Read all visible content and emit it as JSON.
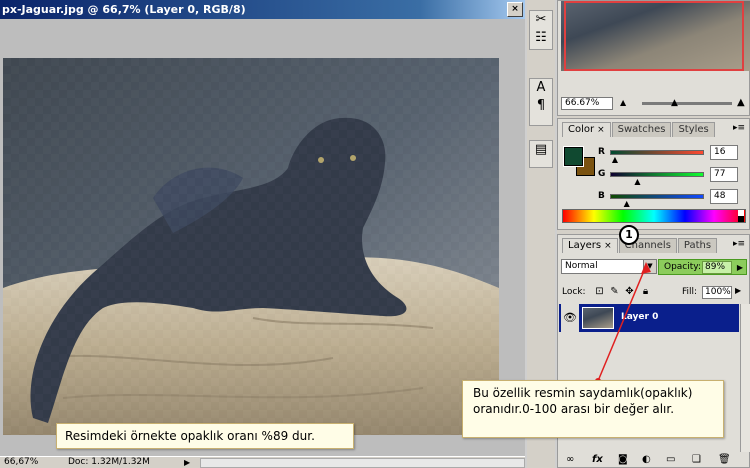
{
  "document": {
    "title": "px-Jaguar.jpg @ 66,7% (Layer 0, RGB/8)",
    "close_label": "×",
    "zoom_status": "66,67%",
    "doc_status": "Doc: 1.32M/1.32M",
    "status_arrow": "▶"
  },
  "navigator": {
    "zoom_value": "66.67%"
  },
  "color_panel": {
    "tabs": [
      {
        "label": "Color",
        "close": "×"
      },
      {
        "label": "Swatches"
      },
      {
        "label": "Styles"
      }
    ],
    "foreground_color": "#104930",
    "background_color": "#7a5210",
    "sliders": [
      {
        "label": "R",
        "value": "16",
        "fraction": 0.063
      },
      {
        "label": "G",
        "value": "77",
        "fraction": 0.302
      },
      {
        "label": "B",
        "value": "48",
        "fraction": 0.188
      }
    ]
  },
  "layers_panel": {
    "tabs": [
      {
        "label": "Layers",
        "close": "×"
      },
      {
        "label": "Channels"
      },
      {
        "label": "Paths"
      }
    ],
    "blend_mode": "Normal",
    "opacity_label": "Opacity:",
    "opacity_value": "89%",
    "lock_label": "Lock:",
    "fill_label": "Fill:",
    "fill_value": "100%",
    "layer_name": "Layer 0",
    "footer_icons": [
      "link-icon",
      "fx-icon",
      "mask-icon",
      "adjustment-icon",
      "folder-icon",
      "new-layer-icon",
      "trash-icon"
    ]
  },
  "annotations": {
    "image_caption": "Resimdeki örnekte opaklık oranı %89 dur.",
    "opacity_caption": "Bu özellik resmin saydamlık(opaklık) oranıdır.0-100 arası bir değer alır.",
    "step_number": "1",
    "accent_color": "#e02020"
  }
}
